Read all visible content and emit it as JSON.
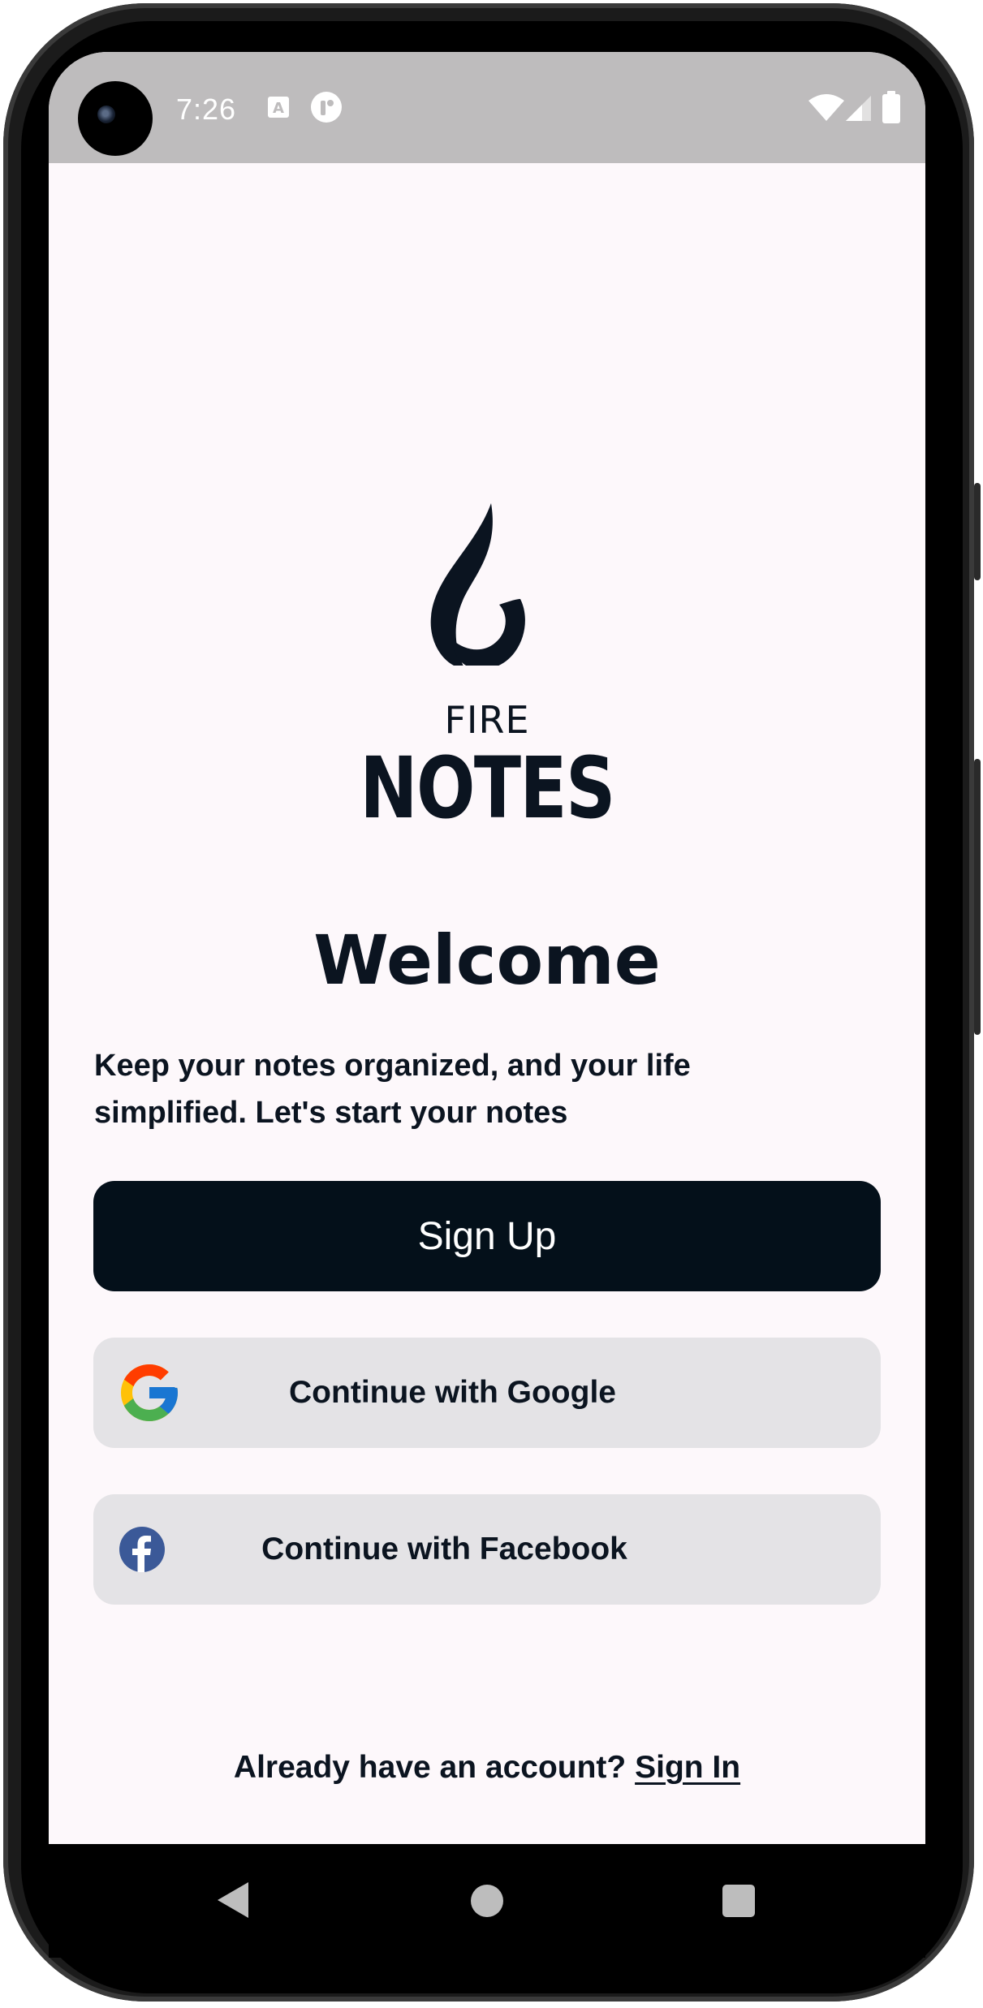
{
  "status_bar": {
    "time": "7:26",
    "icons": [
      "keyboard-a-icon",
      "accessibility-icon",
      "wifi-icon",
      "signal-icon",
      "battery-icon"
    ]
  },
  "brand": {
    "line1": "FIRE",
    "line2": "NOTES",
    "logo_icon": "flame-logo-icon"
  },
  "welcome": {
    "title": "Welcome",
    "tagline_line1": "Keep your notes organized, and your life",
    "tagline_line2": "simplified. Let's start your notes"
  },
  "buttons": {
    "sign_up": "Sign Up",
    "google": "Continue with Google",
    "facebook": "Continue with Facebook"
  },
  "footer": {
    "prompt": "Already have an account?",
    "sign_in": "Sign In"
  },
  "nav_bar": {
    "icons": [
      "back-icon",
      "home-icon",
      "recents-icon"
    ]
  },
  "colors": {
    "screen_bg": "#fdf8fb",
    "primary": "#04101a",
    "secondary_bg": "#e4e3e6",
    "status_bar": "#bebcbd",
    "facebook_blue": "#3b5998"
  }
}
